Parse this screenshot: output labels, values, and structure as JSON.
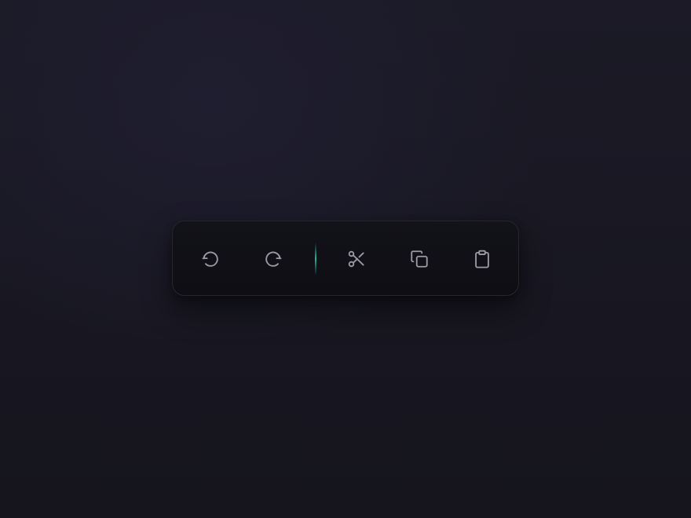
{
  "toolbar": {
    "accent_color": "#1fb5a0",
    "tools": [
      {
        "id": "undo",
        "icon": "undo-icon"
      },
      {
        "id": "redo",
        "icon": "redo-icon"
      },
      {
        "id": "cut",
        "icon": "scissors-icon"
      },
      {
        "id": "copy",
        "icon": "copy-icon"
      },
      {
        "id": "paste",
        "icon": "clipboard-icon"
      }
    ]
  }
}
